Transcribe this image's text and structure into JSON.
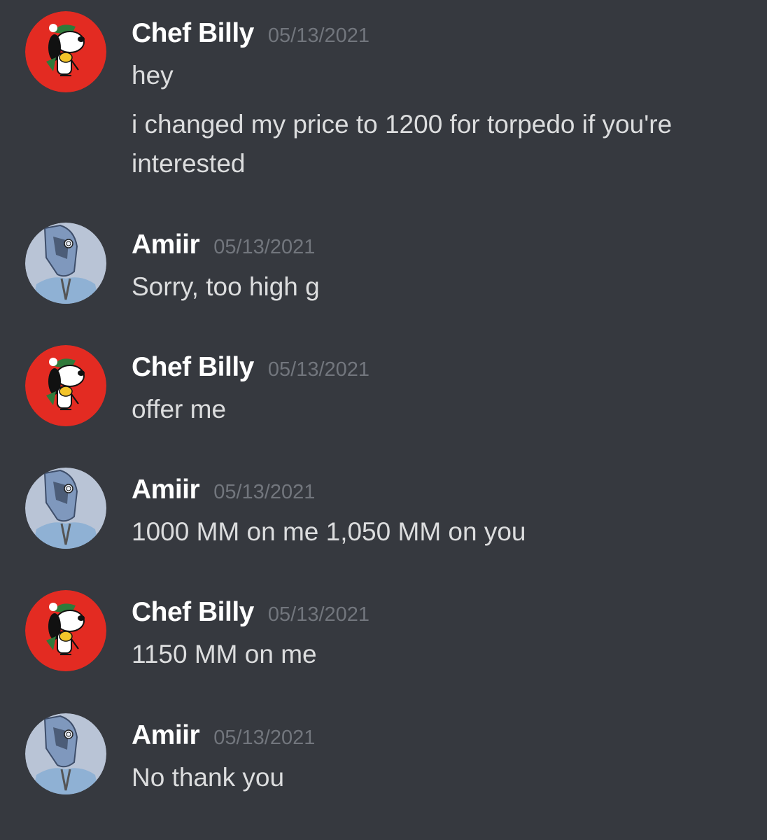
{
  "messages": [
    {
      "author": "Chef Billy",
      "avatar_icon": "snoopy-avatar-icon",
      "timestamp": "05/13/2021",
      "lines": [
        "hey",
        "i changed my price to 1200 for torpedo if you're interested"
      ]
    },
    {
      "author": "Amiir",
      "avatar_icon": "helmet-avatar-icon",
      "timestamp": "05/13/2021",
      "lines": [
        "Sorry, too high g"
      ]
    },
    {
      "author": "Chef Billy",
      "avatar_icon": "snoopy-avatar-icon",
      "timestamp": "05/13/2021",
      "lines": [
        "offer me"
      ]
    },
    {
      "author": "Amiir",
      "avatar_icon": "helmet-avatar-icon",
      "timestamp": "05/13/2021",
      "lines": [
        "1000 MM on me 1,050 MM on you"
      ]
    },
    {
      "author": "Chef Billy",
      "avatar_icon": "snoopy-avatar-icon",
      "timestamp": "05/13/2021",
      "lines": [
        "1150 MM on me"
      ]
    },
    {
      "author": "Amiir",
      "avatar_icon": "helmet-avatar-icon",
      "timestamp": "05/13/2021",
      "lines": [
        "No thank you"
      ]
    }
  ],
  "colors": {
    "background": "#36393f",
    "username": "#ffffff",
    "timestamp": "#72767d",
    "message_text": "#dcddde",
    "snoopy_avatar_bg": "#e32b22",
    "helmet_avatar_bg": "#b9c4d6"
  }
}
